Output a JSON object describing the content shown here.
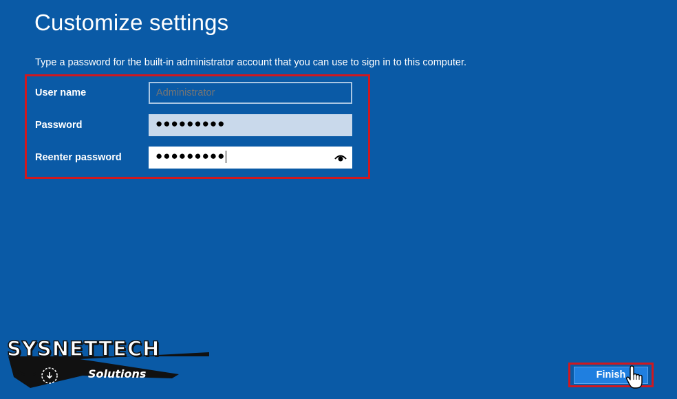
{
  "page": {
    "title": "Customize settings",
    "description": "Type a password for the built-in administrator account that you can use to sign in to this computer."
  },
  "form": {
    "username_label": "User name",
    "username_placeholder": "Administrator",
    "password_label": "Password",
    "password_value": "●●●●●●●●●",
    "reenter_label": "Reenter password",
    "reenter_value": "●●●●●●●●●",
    "reveal_icon": "eye-icon"
  },
  "footer": {
    "finish_label": "Finish",
    "ease_of_access_icon": "ease-of-access-icon",
    "cursor_icon": "hand-cursor-icon"
  },
  "watermark": {
    "main": "SYSNETTECH",
    "sub": "Solutions"
  },
  "colors": {
    "background": "#0a5aa6",
    "highlight": "#d0181f",
    "button": "#1f7fe0"
  }
}
